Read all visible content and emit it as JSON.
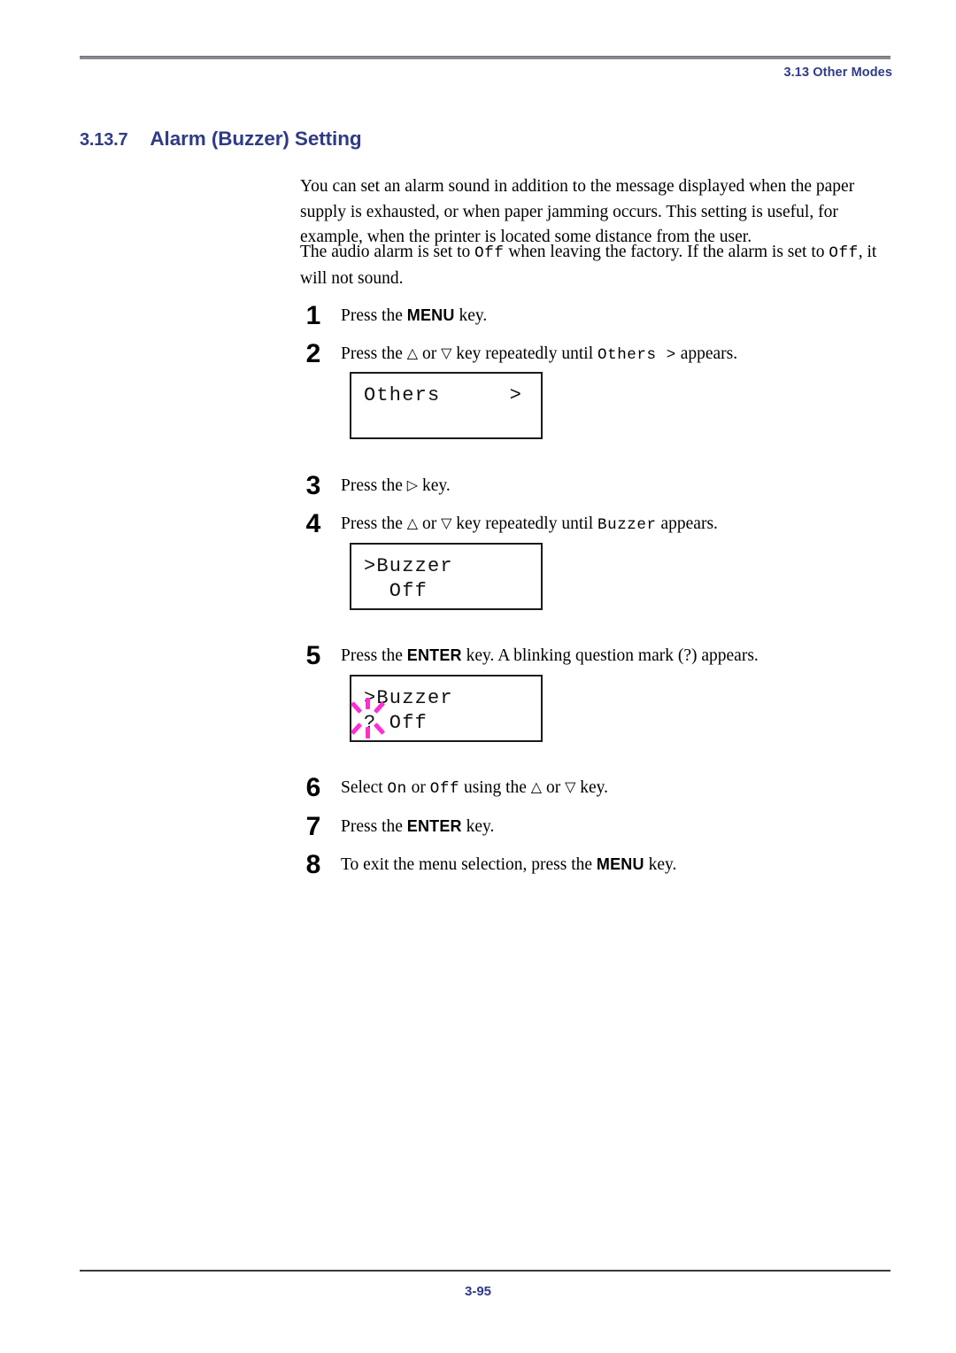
{
  "header": {
    "chapter_ref": "3.13 Other Modes",
    "accent_color": "#2f3b85"
  },
  "section": {
    "number": "3.13.7",
    "title": "Alarm (Buzzer) Setting"
  },
  "paragraphs": {
    "intro_1": "You can set an alarm sound in addition to the message displayed when the paper supply is exhausted, or when paper jamming occurs. This setting is useful, for example, when the printer is located some distance from the user.",
    "intro_2_a": "The audio alarm is set to ",
    "intro_2_off_1": "Off",
    "intro_2_b": " when leaving the factory. If the alarm is set to ",
    "intro_2_off_2": "Off",
    "intro_2_c": ", it will not sound."
  },
  "steps": [
    {
      "number": "1",
      "text_a": "Press the ",
      "key": "MENU",
      "text_b": " key."
    },
    {
      "number": "2",
      "text_a": "Press the ",
      "up_icon": "△",
      "text_mid": " or ",
      "down_icon": "▽",
      "text_b": " key repeatedly until ",
      "mono": "Others  >",
      "text_c": " appears."
    },
    {
      "number": "3",
      "text_a": "Press the ",
      "right_icon": "▷",
      "text_b": " key."
    },
    {
      "number": "4",
      "text_a": "Press the ",
      "up_icon": "△",
      "text_mid": " or ",
      "down_icon": "▽",
      "text_b": " key repeatedly until ",
      "mono": "Buzzer",
      "text_c": " appears."
    },
    {
      "number": "5",
      "text_a": "Press the ",
      "key": "ENTER",
      "text_b": " key. A blinking question mark (?) appears."
    },
    {
      "number": "6",
      "text_a": "Select ",
      "mono_on": "On",
      "text_mid": " or ",
      "mono_off": "Off",
      "text_b": " using the ",
      "up_icon": "△",
      "text_mid2": " or ",
      "down_icon": "▽",
      "text_c": " key."
    },
    {
      "number": "7",
      "text_a": "Press the ",
      "key": "ENTER",
      "text_b": " key."
    },
    {
      "number": "8",
      "text_a": "To exit the menu selection, press the ",
      "key": "MENU",
      "text_b": " key."
    }
  ],
  "lcd_displays": [
    {
      "name": "others-menu",
      "line1": "Others",
      "line1_right": ">",
      "line2": ""
    },
    {
      "name": "buzzer-off",
      "line1": ">Buzzer",
      "line2": "  Off"
    },
    {
      "name": "buzzer-query",
      "line1": ">Buzzer",
      "line2": "? Off",
      "blink_color": "#ff2ed1",
      "blink_target": "?"
    }
  ],
  "footer": {
    "page_number": "3-95"
  }
}
